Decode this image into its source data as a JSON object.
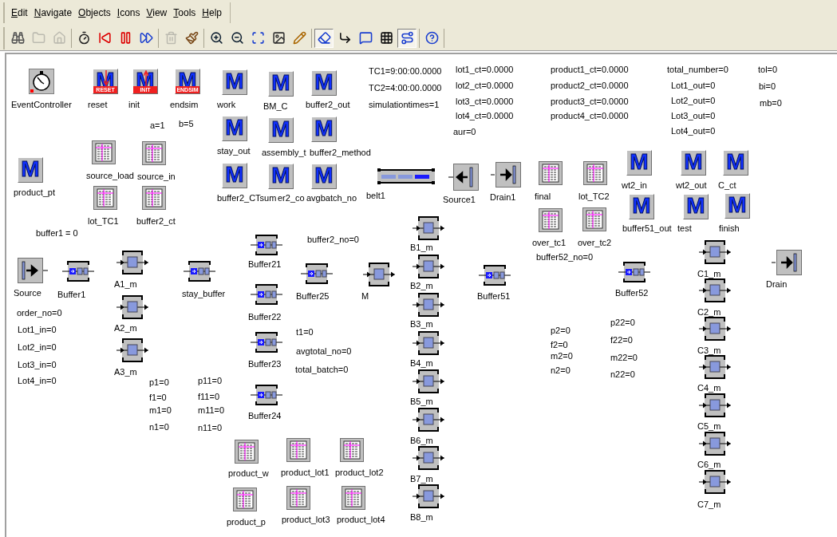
{
  "menu": [
    "Edit",
    "Navigate",
    "Objects",
    "Icons",
    "View",
    "Tools",
    "Help"
  ],
  "toolbar": [
    [
      {
        "kind": "binoculars",
        "selected": false,
        "disabled": false
      },
      {
        "kind": "folder",
        "selected": false,
        "disabled": true
      },
      {
        "kind": "home",
        "selected": false,
        "disabled": true
      }
    ],
    [
      {
        "kind": "timer",
        "selected": false,
        "disabled": false
      },
      {
        "kind": "rewind",
        "selected": false,
        "disabled": false
      },
      {
        "kind": "step",
        "selected": false,
        "disabled": false
      },
      {
        "kind": "fast",
        "selected": false,
        "disabled": false
      }
    ],
    [
      {
        "kind": "trash",
        "selected": false,
        "disabled": true
      },
      {
        "kind": "brush",
        "selected": false,
        "disabled": false
      }
    ],
    [
      {
        "kind": "zoom-in",
        "selected": false,
        "disabled": false
      },
      {
        "kind": "zoom-out",
        "selected": false,
        "disabled": false
      },
      {
        "kind": "fit",
        "selected": false,
        "disabled": false
      },
      {
        "kind": "image",
        "selected": false,
        "disabled": false
      },
      {
        "kind": "pencil",
        "selected": false,
        "disabled": false
      }
    ],
    [
      {
        "kind": "eraser",
        "selected": true,
        "disabled": false
      },
      {
        "kind": "connector",
        "selected": false,
        "disabled": false
      },
      {
        "kind": "comment",
        "selected": false,
        "disabled": false
      },
      {
        "kind": "grid",
        "selected": false,
        "disabled": false
      },
      {
        "kind": "route",
        "selected": true,
        "disabled": false
      }
    ],
    [
      {
        "kind": "help",
        "selected": false,
        "disabled": false
      }
    ]
  ],
  "canvas": {
    "objects": [
      {
        "kind": "event",
        "label": "EventController"
      },
      {
        "kind": "reset-method",
        "label": "reset",
        "glyph": "M",
        "badge": "RESET"
      },
      {
        "kind": "init-method",
        "label": "init",
        "glyph": "M",
        "badge": "INIT"
      },
      {
        "kind": "method",
        "label": "endsim",
        "glyph": "M",
        "badge": "ENDSIM"
      },
      {
        "kind": "method",
        "label": "work",
        "glyph": "M"
      },
      {
        "kind": "method",
        "label": "BM_C",
        "glyph": "M"
      },
      {
        "kind": "method",
        "label": "buffer2_out",
        "glyph": "M"
      },
      {
        "kind": "method",
        "label": "stay_out",
        "glyph": "M"
      },
      {
        "kind": "method",
        "label": "assembly_t",
        "glyph": "M"
      },
      {
        "kind": "method",
        "label": "buffer2_method",
        "glyph": "M"
      },
      {
        "kind": "method",
        "label": "buffer2_CTsum",
        "glyph": "M"
      },
      {
        "kind": "method",
        "label": "er2_co",
        "glyph": "M"
      },
      {
        "kind": "method",
        "label": "avgbatch_no",
        "glyph": "M"
      },
      {
        "kind": "method",
        "label": "product_pt",
        "glyph": "M"
      },
      {
        "kind": "table",
        "label": "source_load"
      },
      {
        "kind": "table",
        "label": "source_in"
      },
      {
        "kind": "table",
        "label": "lot_TC1"
      },
      {
        "kind": "table",
        "label": "buffer2_ct"
      },
      {
        "kind": "belt",
        "label": "belt1"
      },
      {
        "kind": "source",
        "label": "Source1"
      },
      {
        "kind": "drain",
        "label": "Drain1"
      },
      {
        "kind": "table",
        "label": "final"
      },
      {
        "kind": "table",
        "label": "lot_TC2"
      },
      {
        "kind": "table",
        "label": "over_tc1"
      },
      {
        "kind": "table",
        "label": "over_tc2"
      },
      {
        "kind": "method",
        "label": "wt2_in",
        "glyph": "M"
      },
      {
        "kind": "method",
        "label": "wt2_out",
        "glyph": "M"
      },
      {
        "kind": "method",
        "label": "C_ct",
        "glyph": "M"
      },
      {
        "kind": "method",
        "label": "buffer51_out",
        "glyph": "M"
      },
      {
        "kind": "method",
        "label": "test",
        "glyph": "M"
      },
      {
        "kind": "method",
        "label": "finish",
        "glyph": "M"
      },
      {
        "kind": "source",
        "label": "Source"
      },
      {
        "kind": "buffer",
        "label": "Buffer1"
      },
      {
        "kind": "station",
        "label": "A1_m"
      },
      {
        "kind": "station",
        "label": "A2_m"
      },
      {
        "kind": "station",
        "label": "A3_m"
      },
      {
        "kind": "buffer",
        "label": "stay_buffer"
      },
      {
        "kind": "buffer",
        "label": "Buffer21"
      },
      {
        "kind": "buffer",
        "label": "Buffer22"
      },
      {
        "kind": "buffer",
        "label": "Buffer23"
      },
      {
        "kind": "buffer",
        "label": "Buffer24"
      },
      {
        "kind": "buffer",
        "label": "Buffer25"
      },
      {
        "kind": "station",
        "label": "M"
      },
      {
        "kind": "table",
        "label": "product_w"
      },
      {
        "kind": "table",
        "label": "product_lot1"
      },
      {
        "kind": "table",
        "label": "product_lot2"
      },
      {
        "kind": "table",
        "label": "product_p"
      },
      {
        "kind": "table",
        "label": "product_lot3"
      },
      {
        "kind": "table",
        "label": "product_lot4"
      },
      {
        "kind": "station",
        "label": "B1_m"
      },
      {
        "kind": "station",
        "label": "B2_m"
      },
      {
        "kind": "station",
        "label": "B3_m"
      },
      {
        "kind": "station",
        "label": "B4_m"
      },
      {
        "kind": "station",
        "label": "B5_m"
      },
      {
        "kind": "station",
        "label": "B6_m"
      },
      {
        "kind": "station",
        "label": "B7_m"
      },
      {
        "kind": "station",
        "label": "B8_m"
      },
      {
        "kind": "buffer",
        "label": "Buffer51"
      },
      {
        "kind": "buffer",
        "label": "Buffer52"
      },
      {
        "kind": "station",
        "label": "C1_m"
      },
      {
        "kind": "station",
        "label": "C2_m"
      },
      {
        "kind": "station",
        "label": "C3_m"
      },
      {
        "kind": "station",
        "label": "C4_m"
      },
      {
        "kind": "station",
        "label": "C5_m"
      },
      {
        "kind": "station",
        "label": "C6_m"
      },
      {
        "kind": "station",
        "label": "C7_m"
      },
      {
        "kind": "drain",
        "label": "Drain"
      }
    ],
    "variables": [
      "a=1",
      "b=5",
      "buffer1 = 0",
      "TC1=9:00:00.0000",
      "TC2=4:00:00.0000",
      "simulationtimes=1",
      "lot1_ct=0.0000",
      "lot2_ct=0.0000",
      "lot3_ct=0.0000",
      "lot4_ct=0.0000",
      "aur=0",
      "product1_ct=0.0000",
      "product2_ct=0.0000",
      "product3_ct=0.0000",
      "product4_ct=0.0000",
      "total_number=0",
      "Lot1_out=0",
      "Lot2_out=0",
      "Lot3_out=0",
      "Lot4_out=0",
      "tol=0",
      "bi=0",
      "mb=0",
      "buffer2_no=0",
      "buffer52_no=0",
      "order_no=0",
      "Lot1_in=0",
      "Lot2_in=0",
      "Lot3_in=0",
      "Lot4_in=0",
      "p1=0",
      "f1=0",
      "m1=0",
      "n1=0",
      "p11=0",
      "f11=0",
      "m11=0",
      "n11=0",
      "t1=0",
      "avgtotal_no=0",
      "total_batch=0",
      "p2=0",
      "f2=0",
      "m2=0",
      "n2=0",
      "p22=0",
      "f22=0",
      "m22=0",
      "n22=0"
    ]
  }
}
